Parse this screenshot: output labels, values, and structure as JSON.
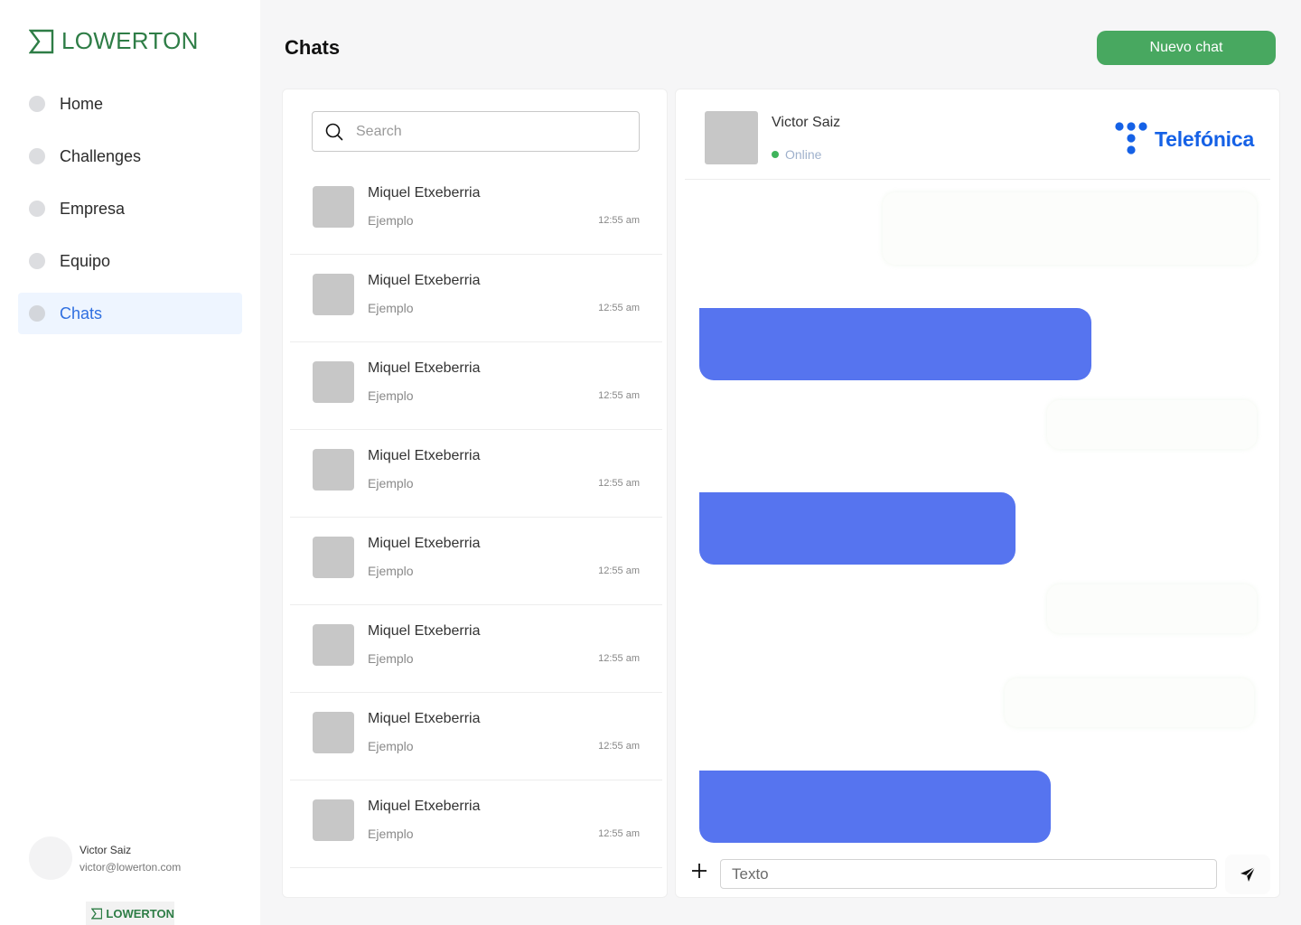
{
  "brand": {
    "name": "LOWERTON"
  },
  "sidebar": {
    "items": [
      {
        "label": "Home",
        "active": false
      },
      {
        "label": "Challenges",
        "active": false
      },
      {
        "label": "Empresa",
        "active": false
      },
      {
        "label": "Equipo",
        "active": false
      },
      {
        "label": "Chats",
        "active": true
      }
    ],
    "user": {
      "name": "Victor Saiz",
      "email": "victor@lowerton.com"
    },
    "footer_brand": "LOWERTON"
  },
  "header": {
    "title": "Chats",
    "new_chat_label": "Nuevo chat"
  },
  "search": {
    "placeholder": "Search",
    "value": ""
  },
  "chats": [
    {
      "name": "Miquel Etxeberria",
      "snippet": "Ejemplo",
      "time": "12:55 am"
    },
    {
      "name": "Miquel Etxeberria",
      "snippet": "Ejemplo",
      "time": "12:55 am"
    },
    {
      "name": "Miquel Etxeberria",
      "snippet": "Ejemplo",
      "time": "12:55 am"
    },
    {
      "name": "Miquel Etxeberria",
      "snippet": "Ejemplo",
      "time": "12:55 am"
    },
    {
      "name": "Miquel Etxeberria",
      "snippet": "Ejemplo",
      "time": "12:55 am"
    },
    {
      "name": "Miquel Etxeberria",
      "snippet": "Ejemplo",
      "time": "12:55 am"
    },
    {
      "name": "Miquel Etxeberria",
      "snippet": "Ejemplo",
      "time": "12:55 am"
    },
    {
      "name": "Miquel Etxeberria",
      "snippet": "Ejemplo",
      "time": "12:55 am"
    }
  ],
  "conversation": {
    "contact_name": "Victor Saiz",
    "status": "Online",
    "company": "Telefónica",
    "composer_placeholder": "Texto"
  },
  "colors": {
    "brand_green": "#2e7d46",
    "button_green": "#48a860",
    "active_nav": "#2f6fe0",
    "outgoing_bubble": "#5674ef",
    "online": "#3fb45b",
    "company_blue": "#1561e6"
  },
  "icons": {
    "search": "search-icon",
    "plus": "plus-icon",
    "send": "send-icon"
  }
}
